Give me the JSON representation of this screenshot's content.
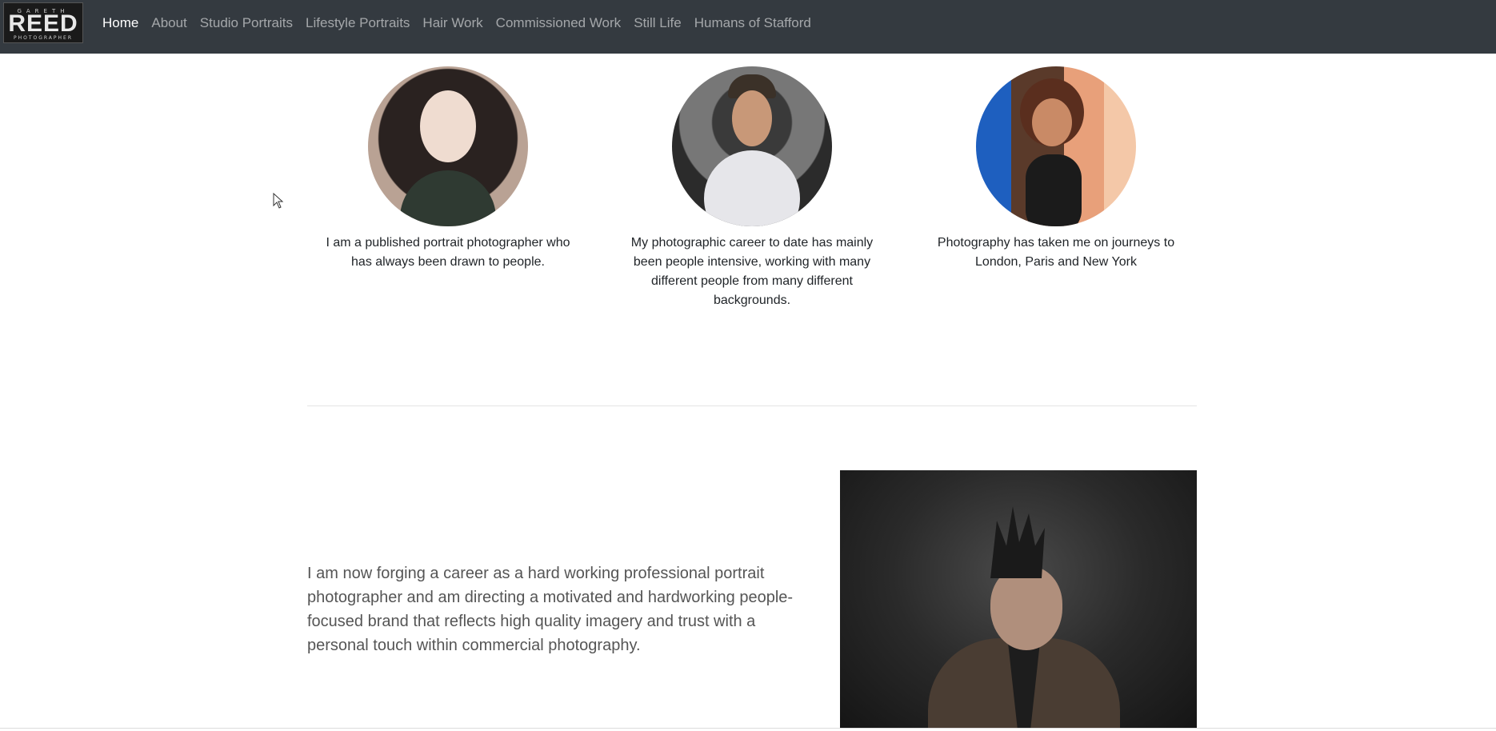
{
  "brand": {
    "logo_top": "GARETH",
    "logo_main": "REED",
    "logo_bottom": "PHOTOGRAPHER"
  },
  "nav": {
    "items": [
      {
        "label": "Home",
        "active": true
      },
      {
        "label": "About"
      },
      {
        "label": "Studio Portraits"
      },
      {
        "label": "Lifestyle Portraits"
      },
      {
        "label": "Hair Work"
      },
      {
        "label": "Commissioned Work"
      },
      {
        "label": "Still Life"
      },
      {
        "label": "Humans of Stafford"
      }
    ]
  },
  "features": [
    {
      "caption": "I am a published portrait photographer who has always been drawn to people."
    },
    {
      "caption": "My photographic career to date has mainly been people intensive, working with many different people from many different backgrounds."
    },
    {
      "caption": "Photography has taken me on journeys to London, Paris and New York"
    }
  ],
  "featurette": {
    "lead": "I am now forging a career as a hard working professional portrait photographer and am directing a motivated and hardworking people-focused brand that reflects high quality imagery and trust with a personal touch within commercial photography."
  },
  "colors": {
    "navbar_bg": "#343a40",
    "nav_active": "#ffffff",
    "nav_inactive": "rgba(255,255,255,0.55)"
  }
}
